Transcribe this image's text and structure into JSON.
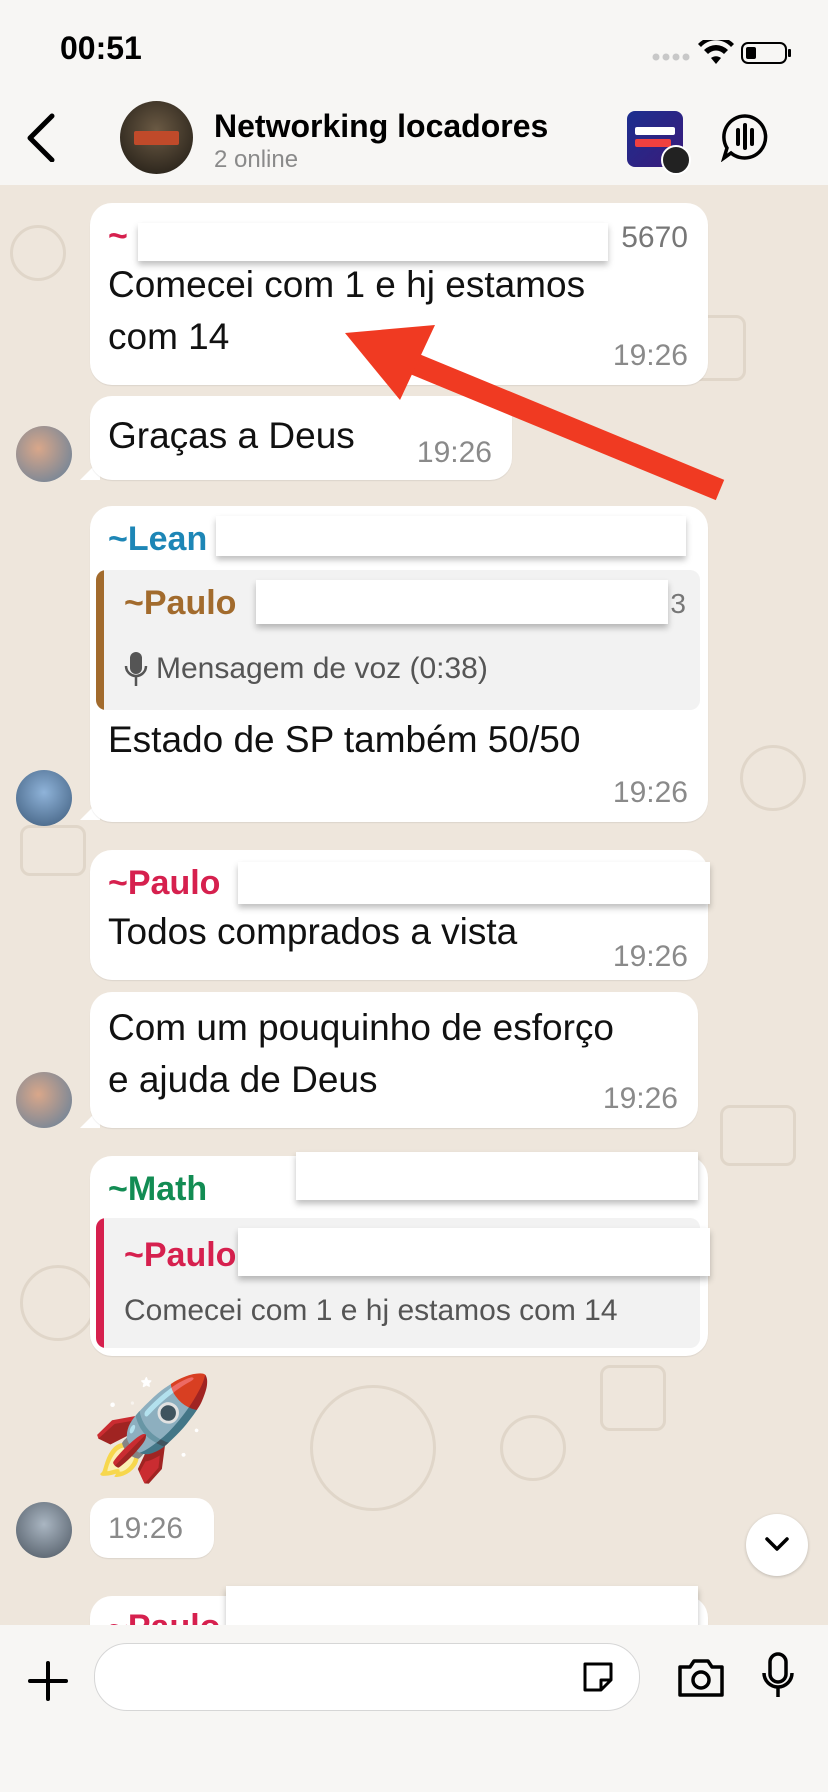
{
  "status_bar": {
    "time": "00:51"
  },
  "header": {
    "title": "Networking locadores",
    "subtitle": "2 online",
    "avatar_icon": "group-avatar-icon",
    "extra_icon": "locacao-extrema-icon"
  },
  "messages": [
    {
      "sender": "~",
      "sender_suffix": "5670",
      "text_line1": "Comecei com 1 e hj estamos",
      "text_line2": "com 14",
      "time": "19:26"
    },
    {
      "text": "Graças a Deus",
      "time": "19:26"
    },
    {
      "sender": "~Lean",
      "quote_sender": "~Paulo",
      "quote_suffix": "3",
      "quote_text": "Mensagem de voz (0:38)",
      "text": "Estado de SP também 50/50",
      "time": "19:26"
    },
    {
      "sender": "~Paulo",
      "text": "Todos comprados a vista",
      "time": "19:26"
    },
    {
      "text_line1": "Com um pouquinho de esforço",
      "text_line2": "e ajuda de Deus",
      "time": "19:26"
    },
    {
      "sender": "~Math",
      "quote_sender": "~Paulo",
      "quote_text": "Comecei com 1 e hj estamos com 14"
    },
    {
      "emoji": "🚀",
      "time": "19:26"
    },
    {
      "sender": "~Paulo"
    }
  ],
  "colors": {
    "red": "#d6204e",
    "blue": "#1d86b6",
    "brown": "#a26b2d",
    "green": "#128c53",
    "arrow": "#f03a22"
  }
}
